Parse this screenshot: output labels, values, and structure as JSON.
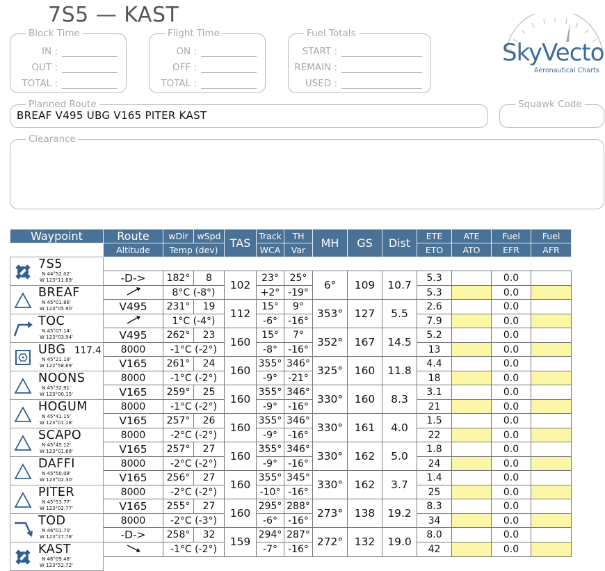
{
  "title": "7S5 — KAST",
  "block_time": {
    "label": "Block Time",
    "fields": [
      "IN :",
      "OUT :",
      "TOTAL :"
    ]
  },
  "flight_time": {
    "label": "Flight Time",
    "fields": [
      "ON :",
      "OFF :",
      "TOTAL :"
    ]
  },
  "fuel_totals": {
    "label": "Fuel Totals",
    "fields": [
      "START :",
      "REMAIN :",
      "USED :"
    ]
  },
  "logo": {
    "name": "SkyVector",
    "tagline": "Aeronautical Charts"
  },
  "planned_route": {
    "label": "Planned Route",
    "value": "BREAF V495 UBG V165 PITER KAST"
  },
  "squawk": {
    "label": "Squawk Code",
    "value": ""
  },
  "clearance": {
    "label": "Clearance",
    "value": ""
  },
  "table": {
    "headers": {
      "waypoint": "Waypoint",
      "route": "Route",
      "altitude": "Altitude",
      "wdir": "wDir",
      "wspd": "wSpd",
      "temp": "Temp (dev)",
      "tas": "TAS",
      "track": "Track",
      "wca": "WCA",
      "th": "TH",
      "var": "Var",
      "mh": "MH",
      "gs": "GS",
      "dist": "Dist",
      "ete": "ETE",
      "eto": "ETO",
      "ate": "ATE",
      "ato": "ATO",
      "fuel1": "Fuel",
      "efr": "EFR",
      "fuel2": "Fuel",
      "afr": "AFR"
    },
    "waypoints": [
      {
        "name": "7S5",
        "lat": "N   44°52.02'",
        "lon": "W 123°11.89'",
        "icon": "airport-icon",
        "freq": ""
      },
      {
        "name": "BREAF",
        "lat": "N   45°01.86'",
        "lon": "W 123°05.90'",
        "icon": "fix-triangle-icon",
        "freq": ""
      },
      {
        "name": "TOC",
        "lat": "N   45°07.14'",
        "lon": "W 123°03.94'",
        "icon": "top-of-climb-icon",
        "freq": ""
      },
      {
        "name": "UBG",
        "lat": "N   45°21.19'",
        "lon": "W 122°58.69'",
        "icon": "vor-icon",
        "freq": "117.4"
      },
      {
        "name": "NOONS",
        "lat": "N   45°32.91'",
        "lon": "W 123°00.15'",
        "icon": "fix-triangle-icon",
        "freq": ""
      },
      {
        "name": "HOGUM",
        "lat": "N   45°41.15'",
        "lon": "W 123°01.18'",
        "icon": "fix-triangle-icon",
        "freq": ""
      },
      {
        "name": "SCAPO",
        "lat": "N   45°45.12'",
        "lon": "W 123°01.68'",
        "icon": "fix-triangle-icon",
        "freq": ""
      },
      {
        "name": "DAFFI",
        "lat": "N   45°50.08'",
        "lon": "W 123°02.30'",
        "icon": "fix-triangle-icon",
        "freq": ""
      },
      {
        "name": "PITER",
        "lat": "N   45°53.77'",
        "lon": "W 123°02.77'",
        "icon": "fix-triangle-icon",
        "freq": ""
      },
      {
        "name": "TOD",
        "lat": "N   46°01.70'",
        "lon": "W 123°27.78'",
        "icon": "top-of-descent-icon",
        "freq": ""
      },
      {
        "name": "KAST",
        "lat": "N   46°09.48'",
        "lon": "W 123°52.72'",
        "icon": "airport-icon",
        "freq": ""
      }
    ],
    "legs": [
      {
        "route": "-D->",
        "alt": "",
        "alt_icon": "climb-arrow-icon",
        "wdir": "182°",
        "wspd": "8",
        "temp": "8°C (-8°)",
        "tas": "102",
        "track": "23°",
        "wca": "+2°",
        "th": "25°",
        "var": "-19°",
        "mh": "6°",
        "gs": "109",
        "dist": "10.7",
        "ete": "5.3",
        "eto": "5.3",
        "fuel": "0.0",
        "efr": "0.0"
      },
      {
        "route": "V495",
        "alt": "",
        "alt_icon": "climb-arrow-icon",
        "wdir": "231°",
        "wspd": "19",
        "temp": "1°C (-4°)",
        "tas": "112",
        "track": "15°",
        "wca": "-6°",
        "th": "9°",
        "var": "-16°",
        "mh": "353°",
        "gs": "127",
        "dist": "5.5",
        "ete": "2.6",
        "eto": "7.9",
        "fuel": "0.0",
        "efr": "0.0"
      },
      {
        "route": "V495",
        "alt": "8000",
        "alt_icon": "",
        "wdir": "262°",
        "wspd": "23",
        "temp": "-1°C (-2°)",
        "tas": "160",
        "track": "15°",
        "wca": "-8°",
        "th": "7°",
        "var": "-16°",
        "mh": "352°",
        "gs": "167",
        "dist": "14.5",
        "ete": "5.2",
        "eto": "13",
        "fuel": "0.0",
        "efr": "0.0"
      },
      {
        "route": "V165",
        "alt": "8000",
        "alt_icon": "",
        "wdir": "261°",
        "wspd": "24",
        "temp": "-1°C (-2°)",
        "tas": "160",
        "track": "355°",
        "wca": "-9°",
        "th": "346°",
        "var": "-21°",
        "mh": "325°",
        "gs": "160",
        "dist": "11.8",
        "ete": "4.4",
        "eto": "18",
        "fuel": "0.0",
        "efr": "0.0"
      },
      {
        "route": "V165",
        "alt": "8000",
        "alt_icon": "",
        "wdir": "259°",
        "wspd": "25",
        "temp": "-1°C (-2°)",
        "tas": "160",
        "track": "355°",
        "wca": "-9°",
        "th": "346°",
        "var": "-16°",
        "mh": "330°",
        "gs": "160",
        "dist": "8.3",
        "ete": "3.1",
        "eto": "21",
        "fuel": "0.0",
        "efr": "0.0"
      },
      {
        "route": "V165",
        "alt": "8000",
        "alt_icon": "",
        "wdir": "257°",
        "wspd": "26",
        "temp": "-2°C (-2°)",
        "tas": "160",
        "track": "355°",
        "wca": "-9°",
        "th": "346°",
        "var": "-16°",
        "mh": "330°",
        "gs": "161",
        "dist": "4.0",
        "ete": "1.5",
        "eto": "22",
        "fuel": "0.0",
        "efr": "0.0"
      },
      {
        "route": "V165",
        "alt": "8000",
        "alt_icon": "",
        "wdir": "257°",
        "wspd": "27",
        "temp": "-2°C (-2°)",
        "tas": "160",
        "track": "355°",
        "wca": "-9°",
        "th": "346°",
        "var": "-16°",
        "mh": "330°",
        "gs": "162",
        "dist": "5.0",
        "ete": "1.8",
        "eto": "24",
        "fuel": "0.0",
        "efr": "0.0"
      },
      {
        "route": "V165",
        "alt": "8000",
        "alt_icon": "",
        "wdir": "256°",
        "wspd": "27",
        "temp": "-2°C (-2°)",
        "tas": "160",
        "track": "355°",
        "wca": "-10°",
        "th": "345°",
        "var": "-16°",
        "mh": "330°",
        "gs": "162",
        "dist": "3.7",
        "ete": "1.4",
        "eto": "25",
        "fuel": "0.0",
        "efr": "0.0"
      },
      {
        "route": "V165",
        "alt": "8000",
        "alt_icon": "",
        "wdir": "255°",
        "wspd": "27",
        "temp": "-2°C (-3°)",
        "tas": "160",
        "track": "295°",
        "wca": "-6°",
        "th": "288°",
        "var": "-16°",
        "mh": "273°",
        "gs": "138",
        "dist": "19.2",
        "ete": "8.3",
        "eto": "34",
        "fuel": "0.0",
        "efr": "0.0"
      },
      {
        "route": "-D->",
        "alt": "",
        "alt_icon": "descent-arrow-icon",
        "wdir": "258°",
        "wspd": "32",
        "temp": "-1°C (-2°)",
        "tas": "159",
        "track": "294°",
        "wca": "-7°",
        "th": "287°",
        "var": "-16°",
        "mh": "272°",
        "gs": "132",
        "dist": "19.0",
        "ete": "8.0",
        "eto": "42",
        "fuel": "0.0",
        "efr": "0.0"
      }
    ]
  }
}
